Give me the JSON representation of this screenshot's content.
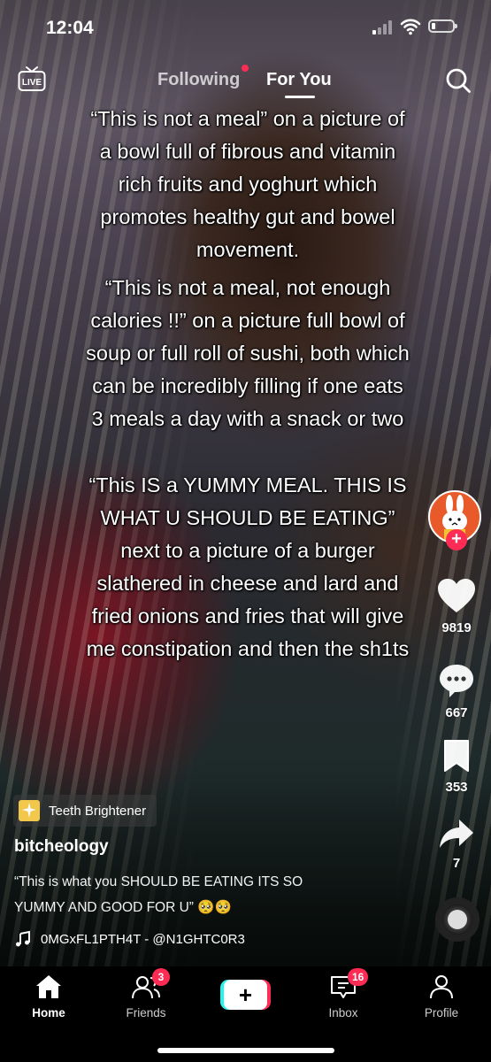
{
  "status_bar": {
    "time": "12:04"
  },
  "top_nav": {
    "live_label": "LIVE",
    "tabs": [
      {
        "label": "Following",
        "has_dot": true
      },
      {
        "label": "For You",
        "active": true
      }
    ]
  },
  "video_text": {
    "paragraph_1": "“This is not a meal” on a picture of a bowl full of fibrous and vitamin rich fruits and yoghurt which promotes healthy gut and bowel movement.",
    "paragraph_2": "“This is not a meal, not enough calories !!” on a picture full bowl of soup or full roll of sushi, both which can be incredibly filling if one eats 3 meals a day with a snack or two",
    "paragraph_3": "“This IS a YUMMY MEAL. THIS IS WHAT U SHOULD BE EATING” next to a picture of a burger slathered in cheese and lard and fried onions and fries that will give me constipation and then the sh1ts"
  },
  "actions": {
    "likes": "9819",
    "comments": "667",
    "bookmarks": "353",
    "shares": "7"
  },
  "post": {
    "effect_label": "Teeth Brightener",
    "username": "bitcheology",
    "caption": "“This is what you SHOULD BE EATING ITS SO YUMMY AND GOOD FOR U” 🥺🥺",
    "sound": "0MGxFL1PTH4T - @N1GHTC0R3"
  },
  "bottom_nav": {
    "items": [
      {
        "label": "Home",
        "icon": "home-icon",
        "active": true
      },
      {
        "label": "Friends",
        "icon": "friends-icon",
        "badge": "3"
      },
      {
        "label": "+",
        "icon": "create-icon"
      },
      {
        "label": "Inbox",
        "icon": "inbox-icon",
        "badge": "16"
      },
      {
        "label": "Profile",
        "icon": "profile-icon"
      }
    ]
  },
  "colors": {
    "accent": "#fe2c55",
    "cyan": "#25f4ee",
    "nav_bg": "#000000"
  }
}
